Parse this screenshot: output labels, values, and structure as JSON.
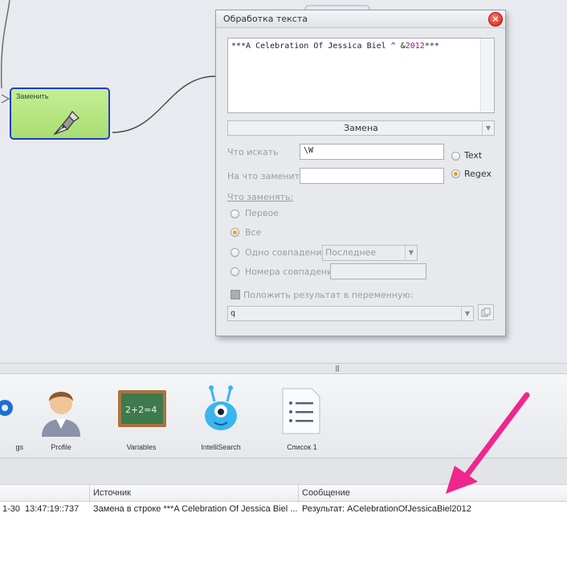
{
  "canvas": {
    "block": {
      "label": "Заменить",
      "icon": "pen-nib-icon"
    }
  },
  "dialog": {
    "title": "Обработка текста",
    "close_icon": "close-icon",
    "input_text_prefix": "***A Celebration Of Jessica Biel ^ &",
    "input_text_number": "2012",
    "input_text_suffix": "***",
    "mode": "Замена",
    "find_label": "Что искать",
    "find_value": "\\W",
    "replace_label": "На что заменить",
    "replace_value": "",
    "match_type_options": [
      {
        "label": "Text",
        "selected": false
      },
      {
        "label": "Regex",
        "selected": true
      }
    ],
    "what_replace_label": "Что заменять:",
    "scope_options": [
      {
        "label": "Первое",
        "selected": false
      },
      {
        "label": "Все",
        "selected": true
      },
      {
        "label": "Одно совпадение",
        "selected": false
      },
      {
        "label": "Номера совпадений",
        "selected": false
      }
    ],
    "single_match_select": "Последнее",
    "match_numbers_value": "",
    "save_result_label": "Положить результат в переменную:",
    "variable_value": "q",
    "variable_button_icon": "copy-icon"
  },
  "toolbar": {
    "items": [
      {
        "label": "gs",
        "icon": "settings-icon"
      },
      {
        "label": "Profile",
        "icon": "profile-icon"
      },
      {
        "label": "Variables",
        "icon": "chalkboard-icon"
      },
      {
        "label": "IntelliSearch",
        "icon": "monster-icon"
      },
      {
        "label": "Список 1",
        "icon": "list-icon"
      }
    ]
  },
  "log": {
    "columns": [
      "Источник",
      "Сообщение"
    ],
    "rows": [
      {
        "date": "1-30",
        "time": "13:47:19::737",
        "source": "Замена в строке ***A Celebration Of Jessica Biel ...",
        "message": "Результат: ACelebrationOfJessicaBiel2012"
      }
    ]
  },
  "colors": {
    "block_fill": "#b4e47f",
    "block_border": "#1f3fbf",
    "radio_selected": "#e9a21b",
    "annotation_arrow": "#f0258d"
  }
}
